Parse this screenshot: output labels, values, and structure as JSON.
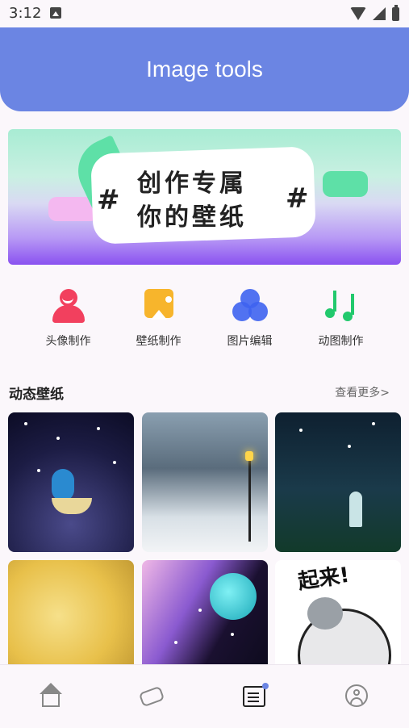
{
  "status_bar": {
    "time": "3:12",
    "icons": [
      "image-notification-icon",
      "wifi-icon",
      "signal-icon",
      "battery-icon"
    ]
  },
  "header": {
    "title": "Image tools",
    "background_color": "#6b85e3"
  },
  "banner": {
    "line1": "创作专属",
    "line2": "你的壁纸",
    "hash_left": "#",
    "hash_right": "#"
  },
  "actions": [
    {
      "label": "头像制作",
      "icon": "avatar-icon",
      "color": "#f2405e"
    },
    {
      "label": "壁纸制作",
      "icon": "wallpaper-icon",
      "color": "#f7b52c"
    },
    {
      "label": "图片编辑",
      "icon": "image-edit-icon",
      "color": "#3e63f0"
    },
    {
      "label": "动图制作",
      "icon": "music-note-icon",
      "color": "#22c96d"
    }
  ],
  "section": {
    "title": "动态壁纸",
    "more": "查看更多>"
  },
  "wallpapers": [
    {
      "name": "starry-night-umbrella"
    },
    {
      "name": "snowy-street"
    },
    {
      "name": "firefly-girl"
    },
    {
      "name": "yellow-leaves"
    },
    {
      "name": "galaxy-moon"
    },
    {
      "name": "comic-cat"
    }
  ],
  "comic_text": "起来!",
  "bottom_nav": [
    {
      "name": "home",
      "icon": "home-icon"
    },
    {
      "name": "hands",
      "icon": "hand-icon"
    },
    {
      "name": "news",
      "icon": "news-icon",
      "active": true
    },
    {
      "name": "profile",
      "icon": "user-icon"
    }
  ]
}
